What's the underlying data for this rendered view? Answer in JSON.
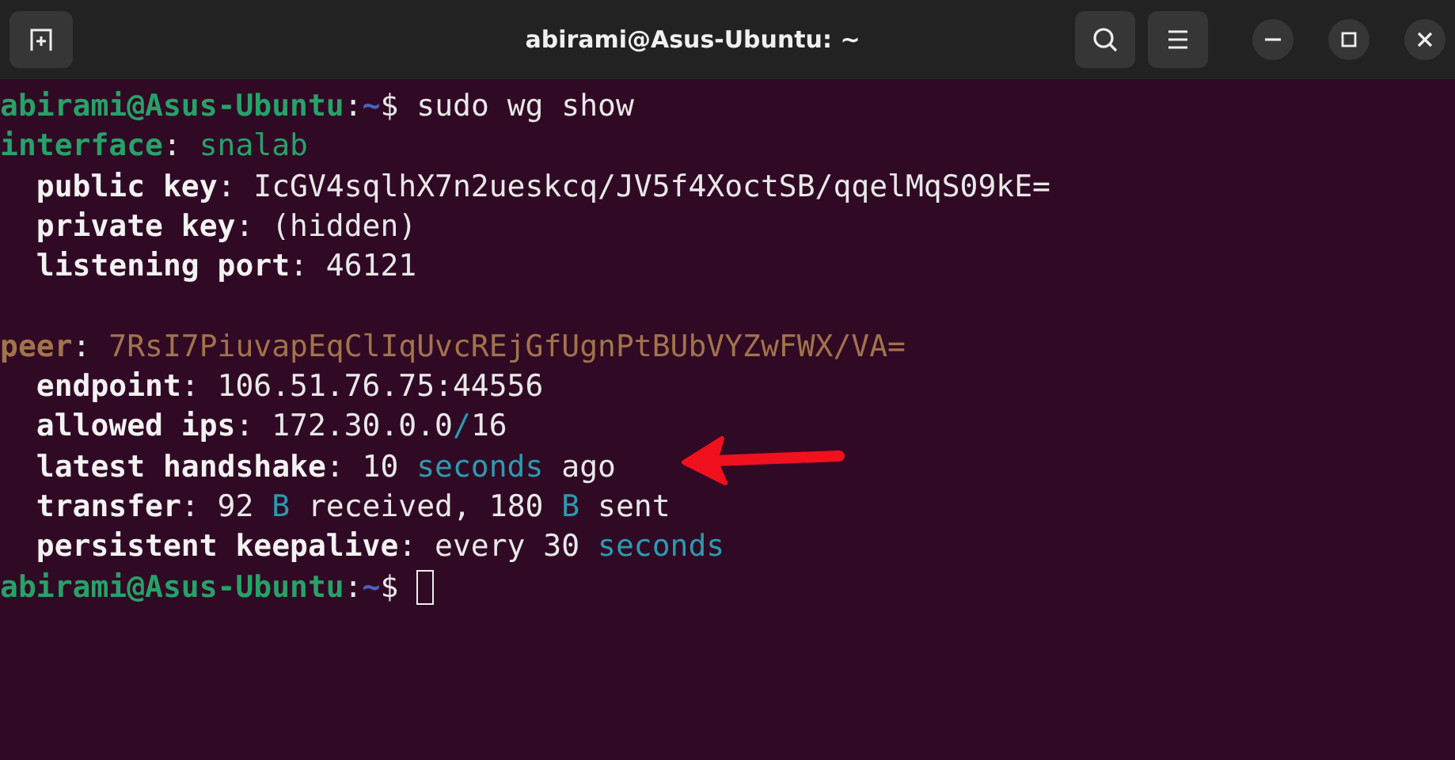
{
  "window": {
    "title": "abirami@Asus-Ubuntu: ~"
  },
  "terminal": {
    "lines": [
      {
        "kind": "text",
        "segments": [
          {
            "text": "abirami@Asus-Ubuntu",
            "kind": "user"
          },
          {
            "text": ":",
            "kind": "plain"
          },
          {
            "text": "~",
            "kind": "path"
          },
          {
            "text": "$ sudo wg show",
            "kind": "plain"
          }
        ]
      },
      {
        "kind": "text",
        "segments": [
          {
            "text": "interface",
            "kind": "section"
          },
          {
            "text": ": ",
            "kind": "plain"
          },
          {
            "text": "snalab",
            "kind": "name"
          }
        ]
      },
      {
        "kind": "text",
        "segments": [
          {
            "text": "  public key",
            "kind": "key"
          },
          {
            "text": ": IcGV4sqlhX7n2ueskcq/JV5f4XoctSB/qqelMqS09kE=",
            "kind": "plain"
          }
        ]
      },
      {
        "kind": "text",
        "segments": [
          {
            "text": "  private key",
            "kind": "key"
          },
          {
            "text": ": (hidden)",
            "kind": "plain"
          }
        ]
      },
      {
        "kind": "text",
        "segments": [
          {
            "text": "  listening port",
            "kind": "key"
          },
          {
            "text": ": 46121",
            "kind": "plain"
          }
        ]
      },
      {
        "kind": "blank"
      },
      {
        "kind": "text",
        "segments": [
          {
            "text": "peer",
            "kind": "peer"
          },
          {
            "text": ": ",
            "kind": "plain"
          },
          {
            "text": "7RsI7PiuvapEqClIqUvcREjGfUgnPtBUbVYZwFWX/VA=",
            "kind": "peerkey"
          }
        ]
      },
      {
        "kind": "text",
        "segments": [
          {
            "text": "  endpoint",
            "kind": "key"
          },
          {
            "text": ": 106.51.76.75:44556",
            "kind": "plain"
          }
        ]
      },
      {
        "kind": "text",
        "segments": [
          {
            "text": "  allowed ips",
            "kind": "key"
          },
          {
            "text": ": 172.30.0.0",
            "kind": "plain"
          },
          {
            "text": "/",
            "kind": "unit"
          },
          {
            "text": "16",
            "kind": "plain"
          }
        ]
      },
      {
        "kind": "text",
        "segments": [
          {
            "text": "  latest handshake",
            "kind": "key"
          },
          {
            "text": ": 10 ",
            "kind": "plain"
          },
          {
            "text": "seconds",
            "kind": "unit"
          },
          {
            "text": " ago",
            "kind": "plain"
          }
        ]
      },
      {
        "kind": "text",
        "segments": [
          {
            "text": "  transfer",
            "kind": "key"
          },
          {
            "text": ": 92 ",
            "kind": "plain"
          },
          {
            "text": "B",
            "kind": "unit"
          },
          {
            "text": " received, 180 ",
            "kind": "plain"
          },
          {
            "text": "B",
            "kind": "unit"
          },
          {
            "text": " sent",
            "kind": "plain"
          }
        ]
      },
      {
        "kind": "text",
        "segments": [
          {
            "text": "  persistent keepalive",
            "kind": "key"
          },
          {
            "text": ": every 30 ",
            "kind": "plain"
          },
          {
            "text": "seconds",
            "kind": "unit"
          }
        ]
      },
      {
        "kind": "prompt",
        "segments": [
          {
            "text": "abirami@Asus-Ubuntu",
            "kind": "user"
          },
          {
            "text": ":",
            "kind": "plain"
          },
          {
            "text": "~",
            "kind": "path"
          },
          {
            "text": "$ ",
            "kind": "plain"
          }
        ]
      }
    ]
  }
}
